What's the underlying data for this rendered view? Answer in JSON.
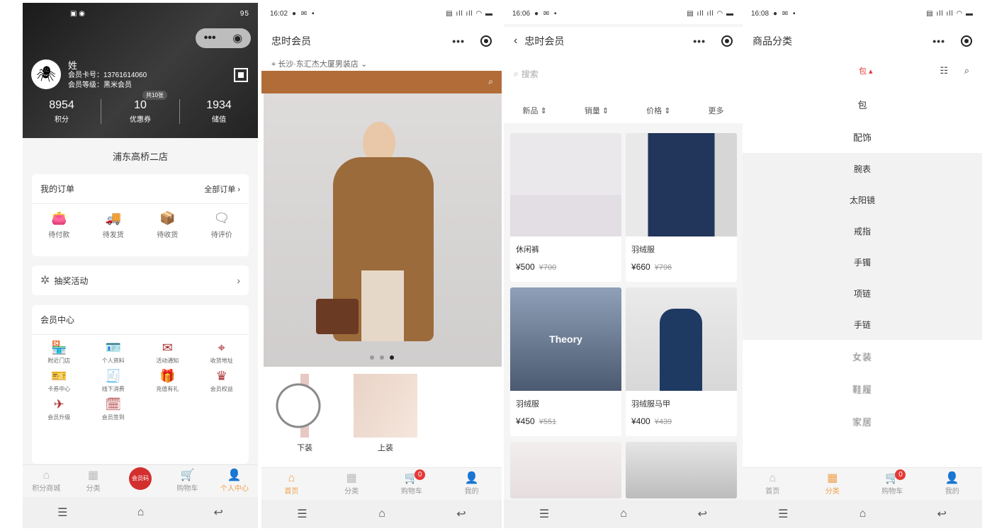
{
  "phone1": {
    "status": {
      "right": "95"
    },
    "user": {
      "name": "姓",
      "card_label": "会员卡号：13761614060",
      "level_label": "会员等级：黑米会员"
    },
    "stats": [
      {
        "value": "8954",
        "label": "积分"
      },
      {
        "value": "10",
        "label": "优惠券",
        "tag": "共10张"
      },
      {
        "value": "1934",
        "label": "储值"
      }
    ],
    "store": "浦东高桥二店",
    "orders": {
      "title": "我的订单",
      "all_link": "全部订单",
      "items": [
        "待付款",
        "待发货",
        "待收货",
        "待评价"
      ]
    },
    "lottery": {
      "label": "抽奖活动"
    },
    "member_center": {
      "title": "会员中心",
      "items": [
        "附近门店",
        "个人资料",
        "活动通知",
        "收货地址",
        "卡券中心",
        "线下消费",
        "充值有礼",
        "会员权益",
        "会员升级",
        "会员签到"
      ]
    },
    "tabs": [
      "积分商城",
      "分类",
      "会员码",
      "购物车",
      "个人中心"
    ]
  },
  "phone2": {
    "status": {
      "time": "16:02"
    },
    "title": "忠时会员",
    "location": "长沙·东汇杰大厦男装店",
    "categories": [
      "下装",
      "上装"
    ],
    "tabs": [
      "首页",
      "分类",
      "购物车",
      "我的"
    ],
    "cart_count": "0"
  },
  "phone3": {
    "status": {
      "time": "16:06"
    },
    "title": "忠时会员",
    "search_placeholder": "搜索",
    "sort": [
      "新品",
      "销量",
      "价格",
      "更多"
    ],
    "products": [
      {
        "name": "休闲裤",
        "price": "¥500",
        "old_price": "¥700"
      },
      {
        "name": "羽绒服",
        "price": "¥660",
        "old_price": "¥796"
      },
      {
        "name": "羽绒服",
        "price": "¥450",
        "old_price": "¥551",
        "brand": "Theory"
      },
      {
        "name": "羽绒服马甲",
        "price": "¥400",
        "old_price": "¥439"
      }
    ]
  },
  "phone4": {
    "status": {
      "time": "16:08"
    },
    "title": "商品分类",
    "current": "包 ▴",
    "categories": [
      "包",
      "配饰"
    ],
    "subcategories": [
      "腕表",
      "太阳镜",
      "戒指",
      "手镯",
      "项链",
      "手链"
    ],
    "more": [
      "女装",
      "鞋履",
      "家居"
    ],
    "tabs": [
      "首页",
      "分类",
      "购物车",
      "我的"
    ],
    "cart_count": "0"
  },
  "colors": {
    "accent": "#f0a04b",
    "brand_band": "#b26c38",
    "badge": "#e53935"
  }
}
